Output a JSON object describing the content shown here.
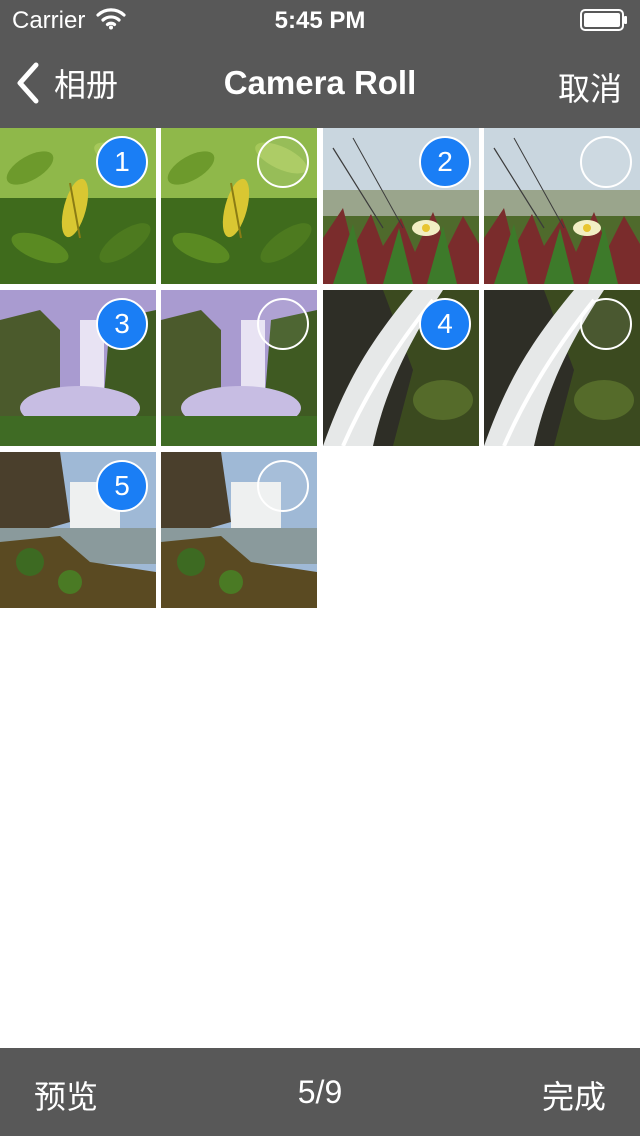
{
  "status_bar": {
    "carrier": "Carrier",
    "time": "5:45 PM",
    "wifi_icon": "wifi-icon",
    "battery_icon": "battery-icon"
  },
  "nav": {
    "back_label": "相册",
    "back_icon": "chevron-left-icon",
    "title": "Camera Roll",
    "cancel_label": "取消"
  },
  "photos": [
    {
      "subject": "leaf",
      "selected": true,
      "index": "1"
    },
    {
      "subject": "leaf",
      "selected": false,
      "index": ""
    },
    {
      "subject": "flower",
      "selected": true,
      "index": "2"
    },
    {
      "subject": "flower",
      "selected": false,
      "index": ""
    },
    {
      "subject": "waterfall-purple",
      "selected": true,
      "index": "3"
    },
    {
      "subject": "waterfall-purple",
      "selected": false,
      "index": ""
    },
    {
      "subject": "waterfall-rocks",
      "selected": true,
      "index": "4"
    },
    {
      "subject": "waterfall-rocks",
      "selected": false,
      "index": ""
    },
    {
      "subject": "waterfall-river",
      "selected": true,
      "index": "5"
    },
    {
      "subject": "waterfall-river",
      "selected": false,
      "index": ""
    }
  ],
  "toolbar": {
    "preview_label": "预览",
    "count": "5/9",
    "done_label": "完成"
  },
  "colors": {
    "bars": "#585858",
    "selection": "#1a7ef5",
    "text": "#ffffff"
  }
}
